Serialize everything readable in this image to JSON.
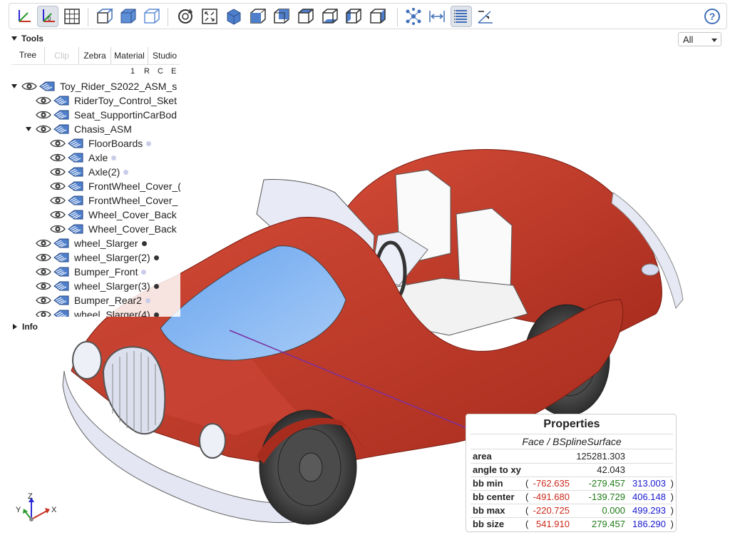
{
  "toolbar": {
    "buttons": [
      {
        "name": "axes-toggle-icon",
        "active": false
      },
      {
        "name": "axes-origin-icon",
        "active": true
      },
      {
        "name": "grid-icon",
        "active": false
      },
      {
        "name": "perspective-icon",
        "active": false
      },
      {
        "name": "transparent-icon",
        "active": false
      },
      {
        "name": "black-edges-icon",
        "active": false
      },
      {
        "name": "reset-view-icon",
        "active": false
      },
      {
        "name": "resize-icon",
        "active": false
      },
      {
        "name": "view-iso-icon",
        "active": false
      },
      {
        "name": "view-front-icon",
        "active": false
      },
      {
        "name": "view-rear-icon",
        "active": false
      },
      {
        "name": "view-top-icon",
        "active": false
      },
      {
        "name": "view-bottom-icon",
        "active": false
      },
      {
        "name": "view-left-icon",
        "active": false
      },
      {
        "name": "view-right-icon",
        "active": false
      },
      {
        "name": "explode-icon",
        "active": false
      },
      {
        "name": "measure-distance-icon",
        "active": false
      },
      {
        "name": "properties-icon",
        "active": true
      },
      {
        "name": "angle-icon",
        "active": false
      }
    ],
    "help_icon": "help-icon"
  },
  "tools": {
    "title": "Tools",
    "tabs": [
      {
        "label": "Tree",
        "state": "active"
      },
      {
        "label": "Clip",
        "state": "disabled"
      },
      {
        "label": "Zebra",
        "state": "normal"
      },
      {
        "label": "Material",
        "state": "normal"
      },
      {
        "label": "Studio",
        "state": "normal"
      }
    ],
    "columns": [
      "1",
      "R",
      "C",
      "E"
    ]
  },
  "tree": {
    "items": [
      {
        "label": "Toy_Rider_S2022_ASM_s",
        "indent": 0,
        "toggle": "down",
        "dot": ""
      },
      {
        "label": "RiderToy_Control_Sket",
        "indent": 1,
        "toggle": "",
        "dot": ""
      },
      {
        "label": "Seat_SupportinCarBod",
        "indent": 1,
        "toggle": "",
        "dot": ""
      },
      {
        "label": "Chasis_ASM",
        "indent": 1,
        "toggle": "down",
        "dot": ""
      },
      {
        "label": "FloorBoards",
        "indent": 2,
        "toggle": "",
        "dot": "light"
      },
      {
        "label": "Axle",
        "indent": 2,
        "toggle": "",
        "dot": "light"
      },
      {
        "label": "Axle(2)",
        "indent": 2,
        "toggle": "",
        "dot": "light"
      },
      {
        "label": "FrontWheel_Cover_(",
        "indent": 2,
        "toggle": "",
        "dot": ""
      },
      {
        "label": "FrontWheel_Cover_",
        "indent": 2,
        "toggle": "",
        "dot": ""
      },
      {
        "label": "Wheel_Cover_Back",
        "indent": 2,
        "toggle": "",
        "dot": ""
      },
      {
        "label": "Wheel_Cover_Back",
        "indent": 2,
        "toggle": "",
        "dot": ""
      },
      {
        "label": "wheel_Slarger",
        "indent": 1,
        "toggle": "",
        "dot": "dark"
      },
      {
        "label": "wheel_Slarger(2)",
        "indent": 1,
        "toggle": "",
        "dot": "dark"
      },
      {
        "label": "Bumper_Front",
        "indent": 1,
        "toggle": "",
        "dot": "light"
      },
      {
        "label": "wheel_Slarger(3)",
        "indent": 1,
        "toggle": "",
        "dot": "dark"
      },
      {
        "label": "Bumper_Rear2",
        "indent": 1,
        "toggle": "",
        "dot": "light"
      },
      {
        "label": "wheel_Slarger(4)",
        "indent": 1,
        "toggle": "",
        "dot": "dark"
      }
    ]
  },
  "info": {
    "title": "Info"
  },
  "view_select": {
    "value": "All"
  },
  "properties": {
    "title": "Properties",
    "subtitle": "Face / BSplineSurface",
    "area_label": "area",
    "area_value": "125281.303",
    "angle_label": "angle to xy",
    "angle_value": "42.043",
    "rows": [
      {
        "label": "bb min",
        "x": "-762.635",
        "y": "-279.457",
        "z": "313.003"
      },
      {
        "label": "bb center",
        "x": "-491.680",
        "y": "-139.729",
        "z": "406.148"
      },
      {
        "label": "bb max",
        "x": "-220.725",
        "y": "0.000",
        "z": "499.293"
      },
      {
        "label": "bb size",
        "x": "541.910",
        "y": "279.457",
        "z": "186.290"
      }
    ],
    "open_paren": "(",
    "close_paren": ")"
  },
  "axes": {
    "x": "X",
    "y": "Y",
    "z": "Z"
  },
  "colors": {
    "body": "#c23a2a",
    "body_dark": "#8e2418",
    "glass": "#7ab0f2",
    "chrome": "#d9dcee",
    "tire": "#3a3a3a",
    "accent_icon": "#3f6fb8"
  }
}
